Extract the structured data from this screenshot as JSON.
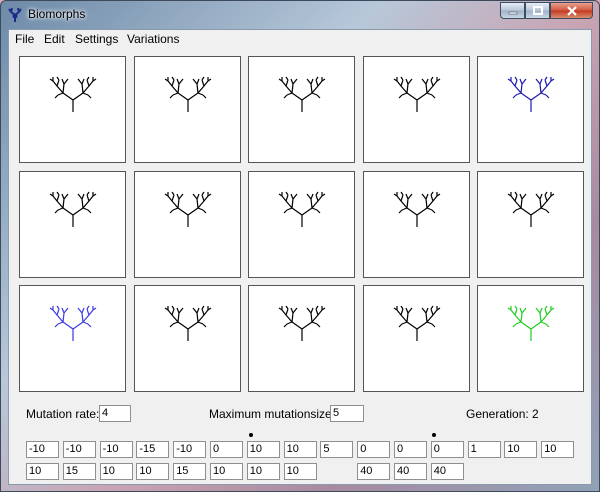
{
  "window": {
    "title": "Biomorphs"
  },
  "menu": [
    "File",
    "Edit",
    "Settings",
    "Variations"
  ],
  "colors": {
    "black": "#000000",
    "blue": "#1a1ab0",
    "lightblue": "#3a3ae0",
    "green": "#22cc22"
  },
  "biomorphs": [
    {
      "color": "black"
    },
    {
      "color": "black"
    },
    {
      "color": "black"
    },
    {
      "color": "black"
    },
    {
      "color": "blue"
    },
    {
      "color": "black"
    },
    {
      "color": "black"
    },
    {
      "color": "black"
    },
    {
      "color": "black"
    },
    {
      "color": "black"
    },
    {
      "color": "lightblue"
    },
    {
      "color": "black"
    },
    {
      "color": "black"
    },
    {
      "color": "black"
    },
    {
      "color": "green"
    }
  ],
  "mutation_rate": {
    "label": "Mutation rate:",
    "value": "4"
  },
  "max_mutation_size": {
    "label": "Maximum mutationsize:",
    "value": "5"
  },
  "generation": {
    "label": "Generation: 2"
  },
  "genes_row1": [
    "-10",
    "-10",
    "-10",
    "-15",
    "-10",
    "0",
    "10",
    "10",
    "5",
    "0",
    "0",
    "0",
    "1",
    "10",
    "10"
  ],
  "genes_row2": [
    "10",
    "15",
    "10",
    "10",
    "15",
    "10",
    "10",
    "10",
    "",
    "40",
    "40",
    "40",
    "",
    "",
    ""
  ]
}
